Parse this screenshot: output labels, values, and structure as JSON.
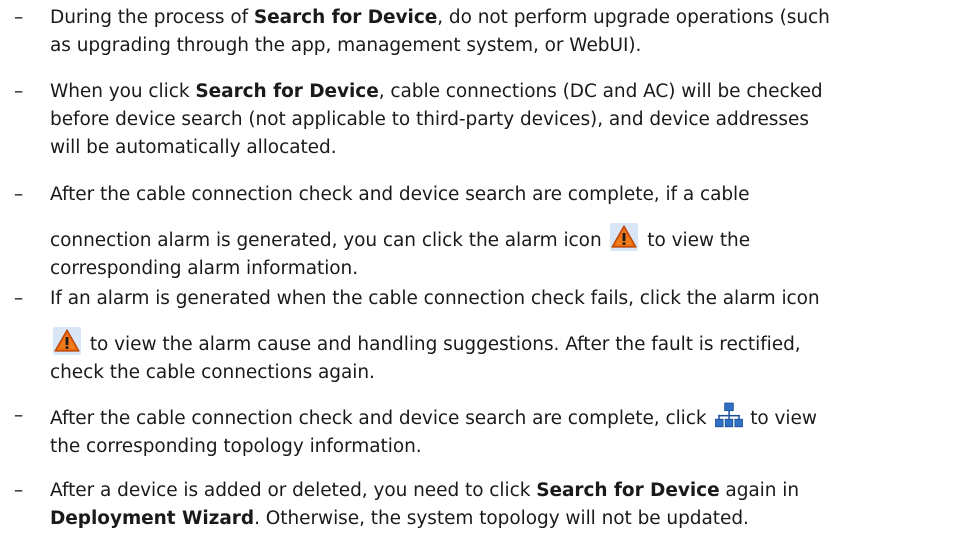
{
  "bullet": "–",
  "items": [
    {
      "parts": [
        {
          "t": "During the process of "
        },
        {
          "b": "Search for Device"
        },
        {
          "t": ", do not perform upgrade operations (such"
        },
        {
          "br": true
        },
        {
          "t": "as upgrading through the app, management system, or WebUI)."
        }
      ]
    },
    {
      "parts": [
        {
          "t": "When you click "
        },
        {
          "b": "Search for Device"
        },
        {
          "t": ", cable connections (DC and AC) will be checked"
        },
        {
          "br": true
        },
        {
          "t": "before device search (not applicable to third-party devices), and device addresses"
        },
        {
          "br": true
        },
        {
          "t": "will be automatically allocated."
        }
      ]
    },
    {
      "parts": [
        {
          "t": "After the cable connection check and device search are complete, if a cable"
        },
        {
          "brgap": true
        },
        {
          "t": "connection alarm is generated, you can click the alarm icon "
        },
        {
          "icon": "alarm-icon"
        },
        {
          "t": " to view the"
        },
        {
          "br": true
        },
        {
          "t": "corresponding alarm information."
        }
      ]
    },
    {
      "parts": [
        {
          "t": "If an alarm is generated when the cable connection check fails, click the alarm icon"
        },
        {
          "brgap": true
        },
        {
          "icon": "alarm-icon"
        },
        {
          "t": " to view the alarm cause and handling suggestions. After the fault is rectified,"
        },
        {
          "br": true
        },
        {
          "t": "check the cable connections again."
        }
      ]
    },
    {
      "parts": [
        {
          "t": "After the cable connection check and device search are complete, click "
        },
        {
          "icon": "topology-icon"
        },
        {
          "t": " to view"
        },
        {
          "br": true
        },
        {
          "t": "the corresponding topology information."
        }
      ]
    },
    {
      "parts": [
        {
          "t": "After a device is added or deleted, you need to click "
        },
        {
          "b": "Search for Device"
        },
        {
          "t": " again in"
        },
        {
          "br": true
        },
        {
          "b": "Deployment Wizard"
        },
        {
          "t": ". Otherwise, the system topology will not be updated."
        }
      ]
    }
  ]
}
